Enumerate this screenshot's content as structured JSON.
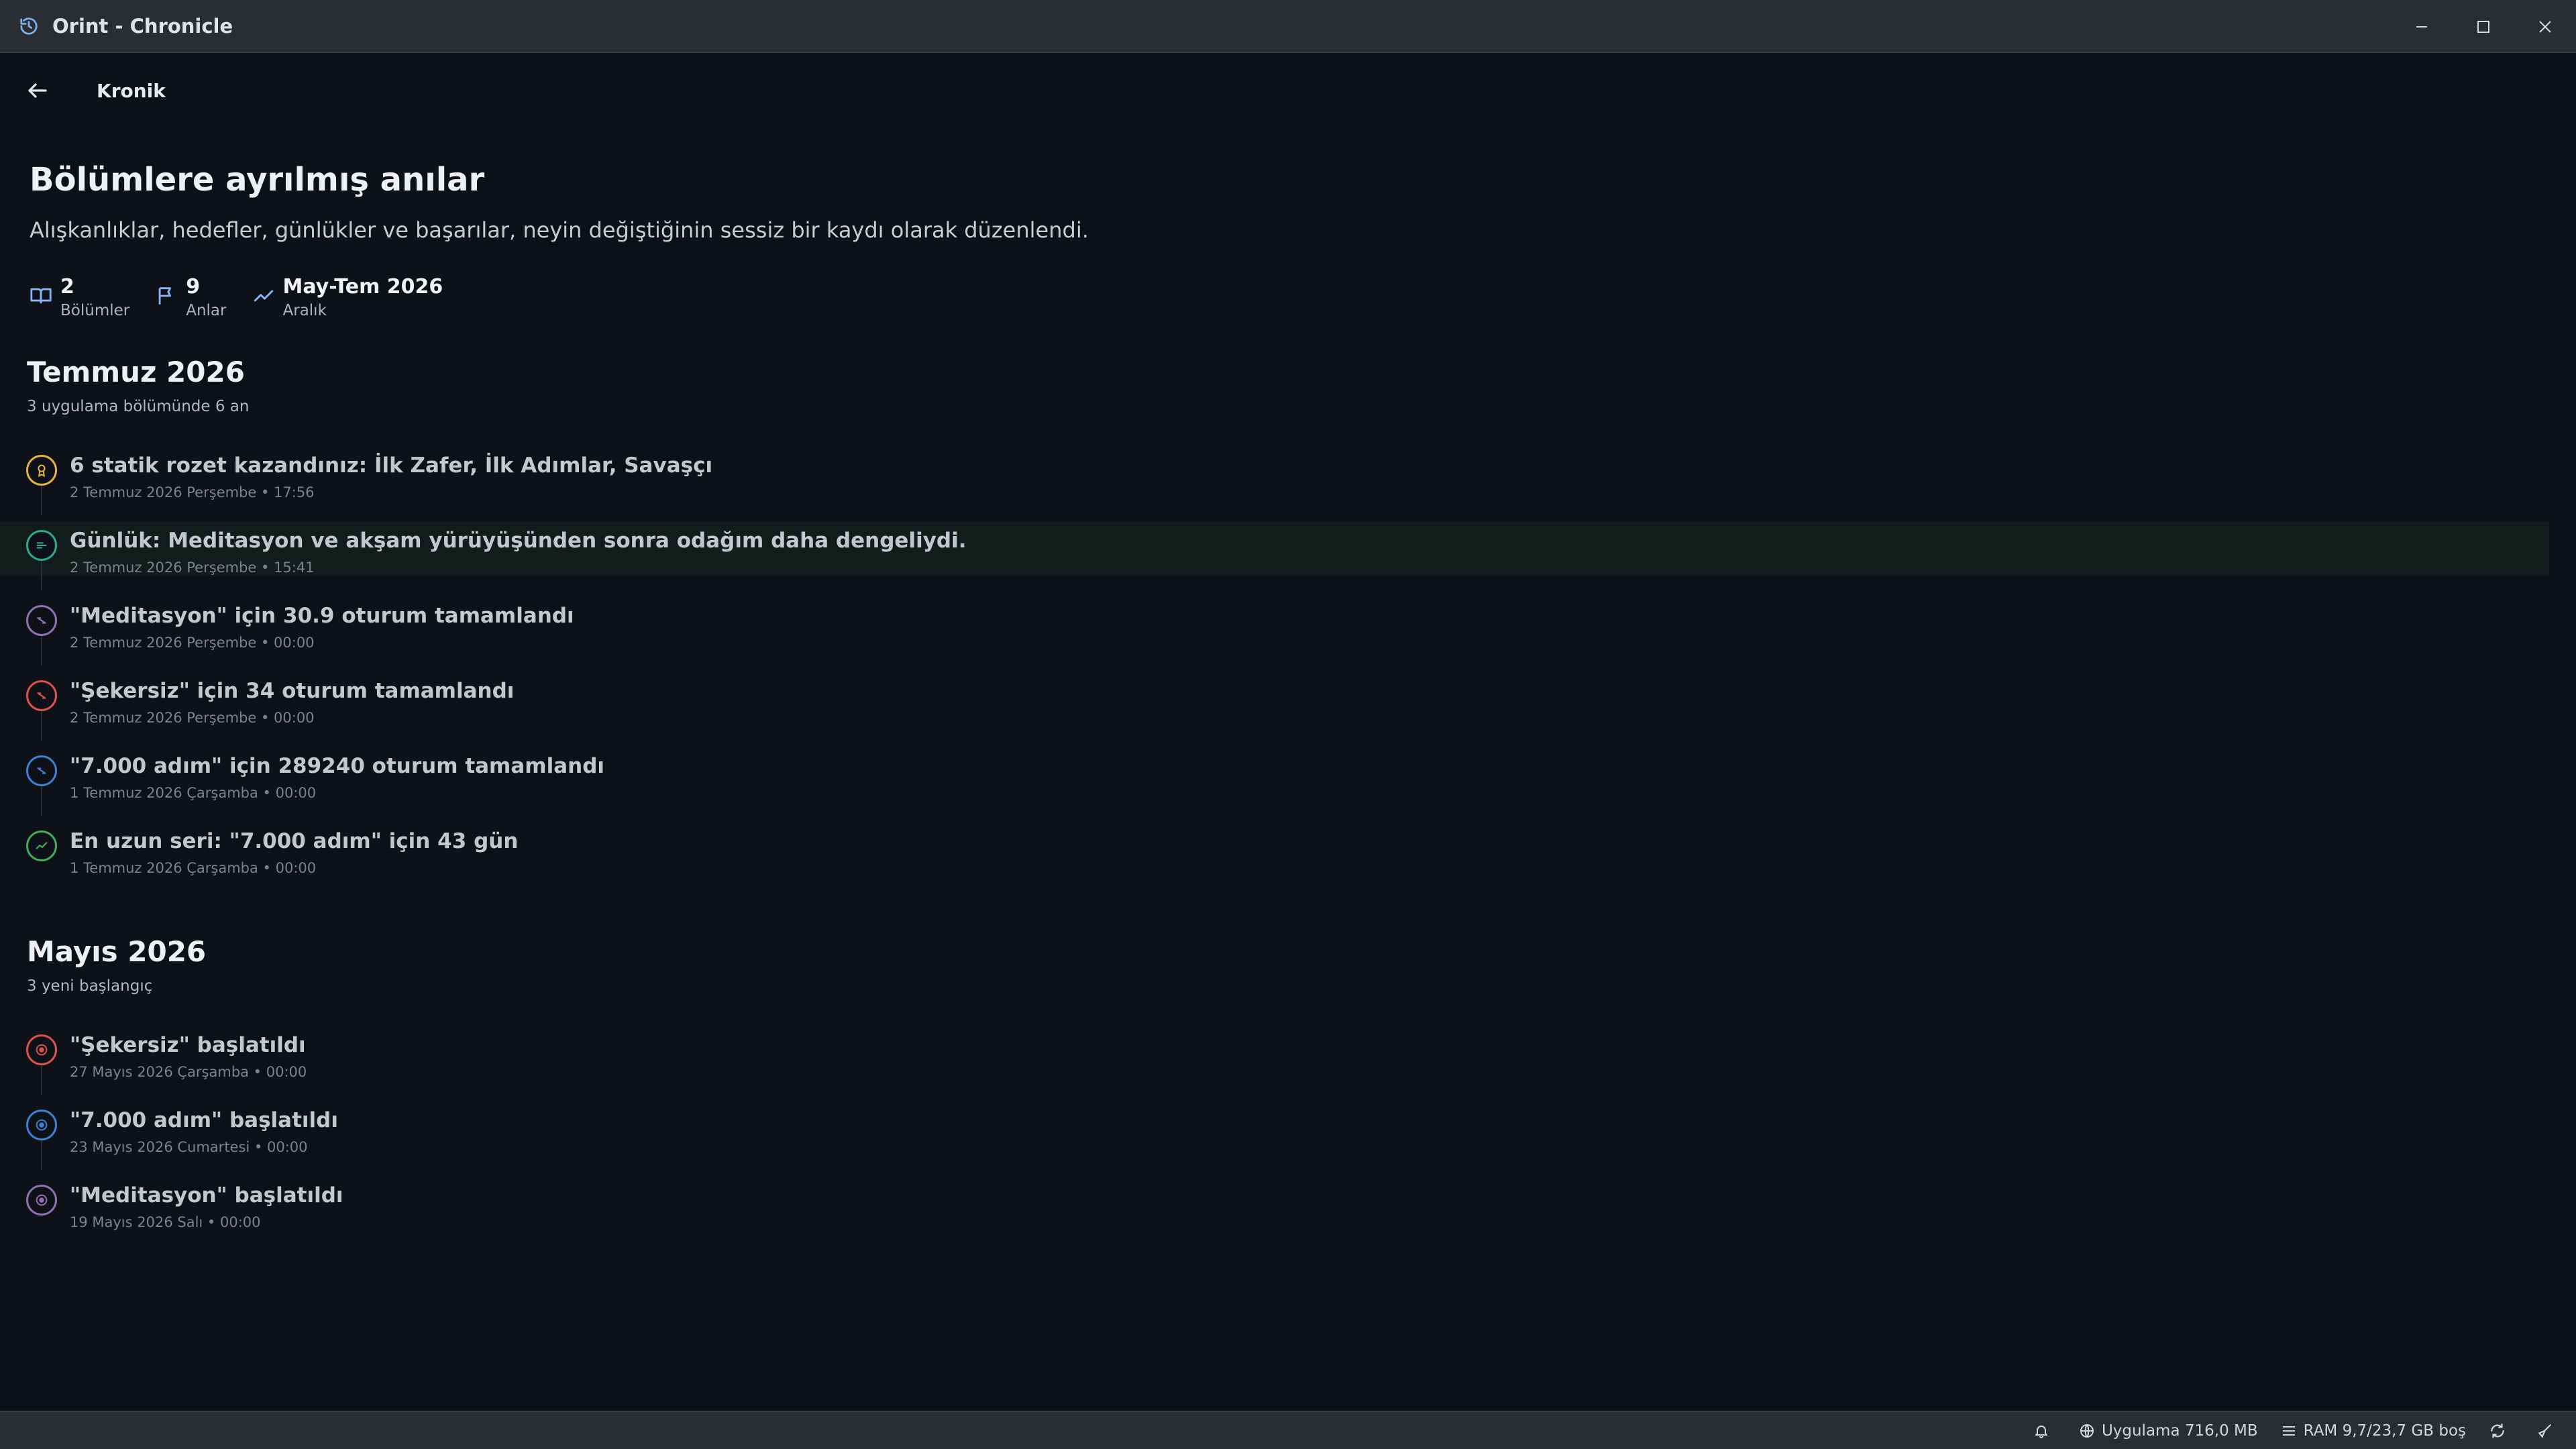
{
  "window": {
    "title": "Orint - Chronicle",
    "controls": {
      "minimize": "minimize-icon",
      "maximize": "maximize-icon",
      "close": "close-icon"
    }
  },
  "nav": {
    "back_icon": "arrow-left-icon",
    "title": "Kronik"
  },
  "hero": {
    "title": "Bölümlere ayrılmış anılar",
    "subtitle": "Alışkanlıklar, hedefler, günlükler ve başarılar, neyin değiştiğinin sessiz bir kaydı olarak düzenlendi."
  },
  "stats": [
    {
      "icon": "book-open-icon",
      "value": "2",
      "label": "Bölümler"
    },
    {
      "icon": "flag-icon",
      "value": "9",
      "label": "Anlar"
    },
    {
      "icon": "trend-icon",
      "value": "May-Tem 2026",
      "label": "Aralık"
    }
  ],
  "sections": [
    {
      "title": "Temmuz 2026",
      "subtitle": "3 uygulama bölümünde 6 an",
      "items": [
        {
          "title": "6 statik rozet kazandınız: İlk Zafer, İlk Adımlar, Savaşçı",
          "meta": "2 Temmuz 2026 Perşembe • 17:56",
          "icon": "award-icon",
          "color": "#e3b341"
        },
        {
          "title": "Günlük: Meditasyon ve akşam yürüyüşünden sonra odağım daha dengeliydi.",
          "meta": "2 Temmuz 2026 Perşembe • 15:41",
          "icon": "journal-icon",
          "color": "#2fa98c"
        },
        {
          "title": "\"Meditasyon\" için 30.9 oturum tamamlandı",
          "meta": "2 Temmuz 2026 Perşembe • 00:00",
          "icon": "progress-icon",
          "color": "#9070b0"
        },
        {
          "title": "\"Şekersiz\" için 34 oturum tamamlandı",
          "meta": "2 Temmuz 2026 Perşembe • 00:00",
          "icon": "progress-icon",
          "color": "#d9534f"
        },
        {
          "title": "\"7.000 adım\" için 289240 oturum tamamlandı",
          "meta": "1 Temmuz 2026 Çarşamba • 00:00",
          "icon": "progress-icon",
          "color": "#3b82d6"
        },
        {
          "title": "En uzun seri: \"7.000 adım\" için 43 gün",
          "meta": "1 Temmuz 2026 Çarşamba • 00:00",
          "icon": "trend-icon",
          "color": "#3fae5a"
        }
      ]
    },
    {
      "title": "Mayıs 2026",
      "subtitle": "3 yeni başlangıç",
      "items": [
        {
          "title": "\"Şekersiz\" başlatıldı",
          "meta": "27 Mayıs 2026 Çarşamba • 00:00",
          "icon": "target-icon",
          "color": "#d9534f"
        },
        {
          "title": "\"7.000 adım\" başlatıldı",
          "meta": "23 Mayıs 2026 Cumartesi • 00:00",
          "icon": "target-icon",
          "color": "#3b82d6"
        },
        {
          "title": "\"Meditasyon\" başlatıldı",
          "meta": "19 Mayıs 2026 Salı • 00:00",
          "icon": "target-icon",
          "color": "#9070b0"
        }
      ]
    }
  ],
  "statusbar": {
    "app_memory": "Uygulama 716,0 MB",
    "ram": "RAM 9,7/23,7 GB boş"
  }
}
